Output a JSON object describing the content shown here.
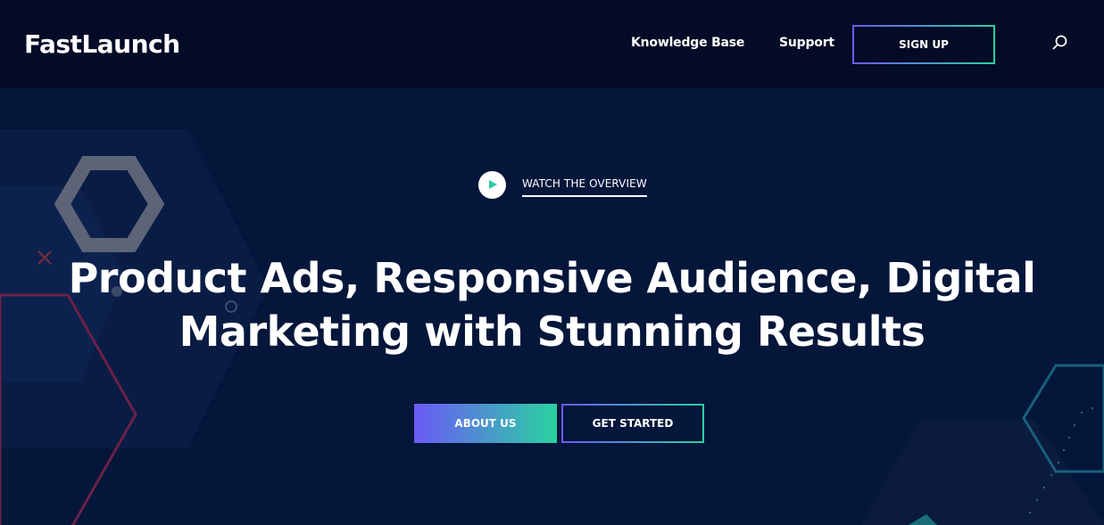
{
  "header": {
    "logo": "FastLaunch",
    "nav": {
      "knowledge_base": "Knowledge Base",
      "support": "Support"
    },
    "signup_label": "SIGN UP",
    "search_icon": "search-icon"
  },
  "hero": {
    "watch_label": "WATCH THE OVERVIEW",
    "play_icon": "play-icon",
    "headline_line1": "Product Ads, Responsive Audience, Digital",
    "headline_line2": "Marketing with Stunning Results",
    "buttons": {
      "about": "ABOUT US",
      "get_started": "GET STARTED"
    }
  },
  "colors": {
    "header_bg": "#030b26",
    "hero_bg": "#04163a",
    "gradient_start": "#6c5af7",
    "gradient_end": "#29d2a0",
    "play_accent": "#29c9a0"
  }
}
